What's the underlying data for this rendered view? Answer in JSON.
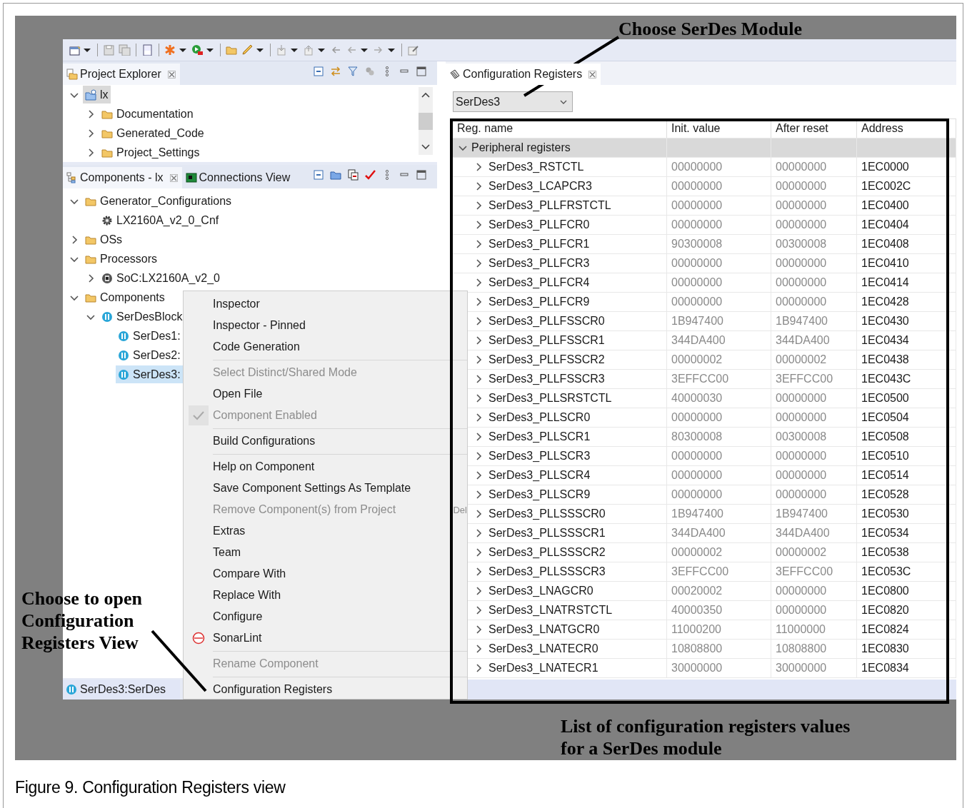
{
  "project_explorer": {
    "title": "Project Explorer",
    "tree": [
      {
        "label": "lx",
        "kind": "project",
        "expanded": true,
        "selected": true,
        "children": [
          {
            "label": "Documentation",
            "kind": "folder",
            "expanded": false,
            "selected": false
          },
          {
            "label": "Generated_Code",
            "kind": "folder",
            "expanded": false,
            "selected": false
          },
          {
            "label": "Project_Settings",
            "kind": "folder",
            "expanded": false,
            "selected": false
          }
        ]
      }
    ]
  },
  "components_view": {
    "tabs": [
      {
        "label": "Components - lx",
        "selected": true
      },
      {
        "label": "Connections View",
        "selected": false
      }
    ],
    "tree": [
      {
        "label": "Generator_Configurations",
        "kind": "folder",
        "expanded": true,
        "selected": false,
        "children": [
          {
            "label": "LX2160A_v2_0_Cnf",
            "kind": "gear",
            "selected": false
          }
        ]
      },
      {
        "label": "OSs",
        "kind": "folder",
        "expanded": false,
        "selected": false
      },
      {
        "label": "Processors",
        "kind": "folder",
        "expanded": true,
        "selected": false,
        "children": [
          {
            "label": "SoC:LX2160A_v2_0",
            "kind": "chip",
            "expanded": false,
            "selected": false
          }
        ]
      },
      {
        "label": "Components",
        "kind": "folder",
        "expanded": true,
        "selected": false,
        "children": [
          {
            "label": "SerDesBlock",
            "kind": "component",
            "expanded": true,
            "selected": false,
            "children": [
              {
                "label": "SerDes1:",
                "kind": "component",
                "selected": false
              },
              {
                "label": "SerDes2:",
                "kind": "component",
                "selected": false
              },
              {
                "label": "SerDes3:",
                "kind": "component",
                "selected": true
              }
            ]
          }
        ]
      }
    ]
  },
  "status_item": "SerDes3:SerDes",
  "config_registers": {
    "title": "Configuration Registers",
    "module": "SerDes3",
    "columns": [
      "Reg. name",
      "Init. value",
      "After reset",
      "Address"
    ],
    "group": {
      "label": "Peripheral registers",
      "expanded": true
    },
    "rows": [
      {
        "name": "SerDes3_RSTCTL",
        "init": "00000000",
        "after_reset": "00000000",
        "address": "1EC0000"
      },
      {
        "name": "SerDes3_LCAPCR3",
        "init": "00000000",
        "after_reset": "00000000",
        "address": "1EC002C"
      },
      {
        "name": "SerDes3_PLLFRSTCTL",
        "init": "00000000",
        "after_reset": "00000000",
        "address": "1EC0400"
      },
      {
        "name": "SerDes3_PLLFCR0",
        "init": "00000000",
        "after_reset": "00000000",
        "address": "1EC0404"
      },
      {
        "name": "SerDes3_PLLFCR1",
        "init": "90300008",
        "after_reset": "00300008",
        "address": "1EC0408"
      },
      {
        "name": "SerDes3_PLLFCR3",
        "init": "00000000",
        "after_reset": "00000000",
        "address": "1EC0410"
      },
      {
        "name": "SerDes3_PLLFCR4",
        "init": "00000000",
        "after_reset": "00000000",
        "address": "1EC0414"
      },
      {
        "name": "SerDes3_PLLFCR9",
        "init": "00000000",
        "after_reset": "00000000",
        "address": "1EC0428"
      },
      {
        "name": "SerDes3_PLLFSSCR0",
        "init": "1B947400",
        "after_reset": "1B947400",
        "address": "1EC0430"
      },
      {
        "name": "SerDes3_PLLFSSCR1",
        "init": "344DA400",
        "after_reset": "344DA400",
        "address": "1EC0434"
      },
      {
        "name": "SerDes3_PLLFSSCR2",
        "init": "00000002",
        "after_reset": "00000002",
        "address": "1EC0438"
      },
      {
        "name": "SerDes3_PLLFSSCR3",
        "init": "3EFFCC00",
        "after_reset": "3EFFCC00",
        "address": "1EC043C"
      },
      {
        "name": "SerDes3_PLLSRSTCTL",
        "init": "40000030",
        "after_reset": "00000000",
        "address": "1EC0500"
      },
      {
        "name": "SerDes3_PLLSCR0",
        "init": "00000000",
        "after_reset": "00000000",
        "address": "1EC0504"
      },
      {
        "name": "SerDes3_PLLSCR1",
        "init": "80300008",
        "after_reset": "00300008",
        "address": "1EC0508"
      },
      {
        "name": "SerDes3_PLLSCR3",
        "init": "00000000",
        "after_reset": "00000000",
        "address": "1EC0510"
      },
      {
        "name": "SerDes3_PLLSCR4",
        "init": "00000000",
        "after_reset": "00000000",
        "address": "1EC0514"
      },
      {
        "name": "SerDes3_PLLSCR9",
        "init": "00000000",
        "after_reset": "00000000",
        "address": "1EC0528"
      },
      {
        "name": "SerDes3_PLLSSSCR0",
        "init": "1B947400",
        "after_reset": "1B947400",
        "address": "1EC0530"
      },
      {
        "name": "SerDes3_PLLSSSCR1",
        "init": "344DA400",
        "after_reset": "344DA400",
        "address": "1EC0534"
      },
      {
        "name": "SerDes3_PLLSSSCR2",
        "init": "00000002",
        "after_reset": "00000002",
        "address": "1EC0538"
      },
      {
        "name": "SerDes3_PLLSSSCR3",
        "init": "3EFFCC00",
        "after_reset": "3EFFCC00",
        "address": "1EC053C"
      },
      {
        "name": "SerDes3_LNAGCR0",
        "init": "00020002",
        "after_reset": "00000000",
        "address": "1EC0800"
      },
      {
        "name": "SerDes3_LNATRSTCTL",
        "init": "40000350",
        "after_reset": "00000000",
        "address": "1EC0820"
      },
      {
        "name": "SerDes3_LNATGCR0",
        "init": "11000200",
        "after_reset": "11000000",
        "address": "1EC0824"
      },
      {
        "name": "SerDes3_LNATECR0",
        "init": "10808800",
        "after_reset": "10808800",
        "address": "1EC0830"
      },
      {
        "name": "SerDes3_LNATECR1",
        "init": "30000000",
        "after_reset": "30000000",
        "address": "1EC0834"
      }
    ]
  },
  "context_menu": [
    {
      "kind": "item",
      "label": "Inspector",
      "disabled": false,
      "checked": false
    },
    {
      "kind": "item",
      "label": "Inspector - Pinned",
      "disabled": false,
      "checked": false
    },
    {
      "kind": "item",
      "label": "Code Generation",
      "disabled": false,
      "checked": false
    },
    {
      "kind": "separator"
    },
    {
      "kind": "item",
      "label": "Select Distinct/Shared Mode",
      "disabled": true,
      "checked": false
    },
    {
      "kind": "item",
      "label": "Open File",
      "disabled": false,
      "checked": false
    },
    {
      "kind": "item",
      "label": "Component Enabled",
      "disabled": true,
      "checked": true
    },
    {
      "kind": "separator"
    },
    {
      "kind": "item",
      "label": "Build Configurations",
      "disabled": false,
      "checked": false
    },
    {
      "kind": "separator"
    },
    {
      "kind": "item",
      "label": "Help on Component",
      "disabled": false,
      "checked": false
    },
    {
      "kind": "item",
      "label": "Save Component Settings As Template",
      "disabled": false,
      "checked": false
    },
    {
      "kind": "item",
      "label": "Remove Component(s) from Project",
      "disabled": true,
      "checked": false,
      "shortcut": "Del"
    },
    {
      "kind": "item",
      "label": "Extras",
      "disabled": false,
      "checked": false
    },
    {
      "kind": "item",
      "label": "Team",
      "disabled": false,
      "checked": false
    },
    {
      "kind": "item",
      "label": "Compare With",
      "disabled": false,
      "checked": false
    },
    {
      "kind": "item",
      "label": "Replace With",
      "disabled": false,
      "checked": false
    },
    {
      "kind": "item",
      "label": "Configure",
      "disabled": false,
      "checked": false
    },
    {
      "kind": "plugin",
      "label": "SonarLint",
      "disabled": false,
      "checked": false
    },
    {
      "kind": "separator"
    },
    {
      "kind": "item",
      "label": "Rename Component",
      "disabled": true,
      "checked": false
    },
    {
      "kind": "separator"
    },
    {
      "kind": "item",
      "label": "Configuration Registers",
      "disabled": false,
      "checked": false
    }
  ],
  "annotations": [
    "Choose SerDes Module",
    "Choose to open Configuration Registers View",
    "List of configuration registers values for a SerDes module"
  ],
  "caption": "Figure 9.  Configuration Registers view"
}
